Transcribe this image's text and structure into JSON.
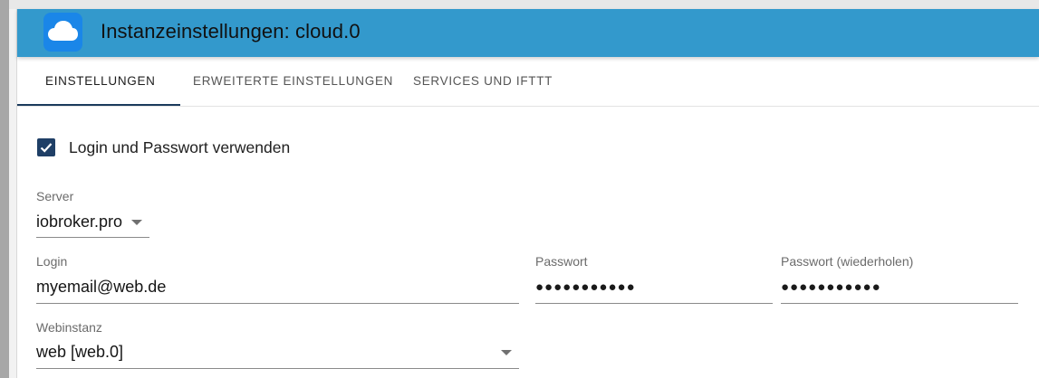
{
  "header": {
    "title": "Instanzeinstellungen: cloud.0",
    "logo_icon": "cloud-icon"
  },
  "tabs": [
    {
      "label": "EINSTELLUNGEN",
      "active": true
    },
    {
      "label": "ERWEITERTE EINSTELLUNGEN",
      "active": false
    },
    {
      "label": "SERVICES UND IFTTT",
      "active": false
    }
  ],
  "use_login": {
    "label": "Login und Passwort verwenden",
    "checked": true
  },
  "server": {
    "label": "Server",
    "value": "iobroker.pro"
  },
  "login": {
    "label": "Login",
    "value": "myemail@web.de"
  },
  "password": {
    "label": "Passwort",
    "value": "●●●●●●●●●●●"
  },
  "password_repeat": {
    "label": "Passwort (wiederholen)",
    "value": "●●●●●●●●●●●"
  },
  "webinstance": {
    "label": "Webinstanz",
    "value": "web [web.0]"
  },
  "colors": {
    "header_bg": "#3399cc",
    "accent": "#1f3f66",
    "logo_bg": "#1a86e8"
  }
}
